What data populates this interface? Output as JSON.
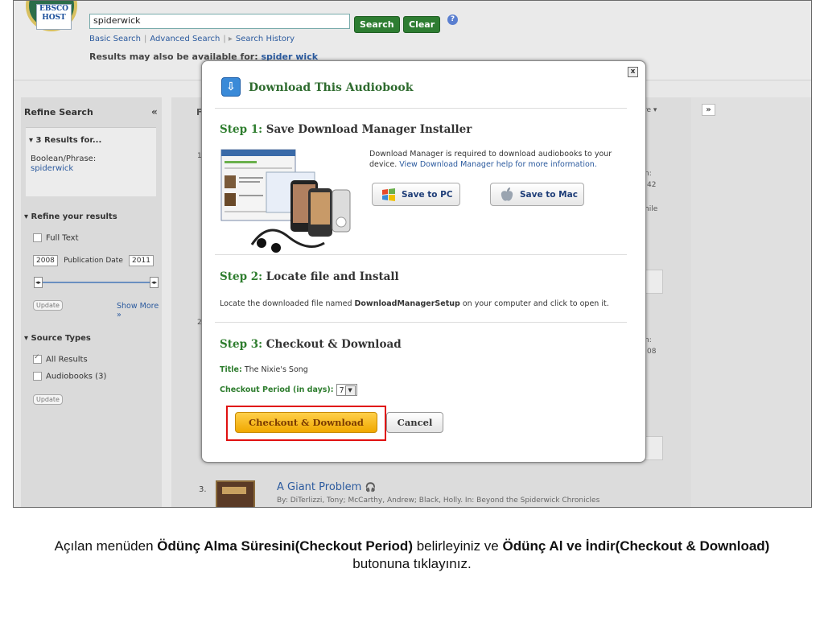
{
  "header": {
    "logo_text": "EBSCO HOST",
    "search_value": "spiderwick",
    "search_button": "Search",
    "clear_button": "Clear",
    "help_icon": "?",
    "nav_links": [
      "Basic Search",
      "Advanced Search",
      "Search History"
    ],
    "may_also_text": "Results may also be available for:",
    "may_also_link": "spider wick"
  },
  "sidebar": {
    "title": "Refine Search",
    "collapse_icon": "«",
    "results_for": "3 Results for...",
    "boolean_label": "Boolean/Phrase:",
    "boolean_value": "spiderwick",
    "refine_header": "Refine your results",
    "full_text": "Full Text",
    "date_from": "2008",
    "date_label": "Publication Date",
    "date_to": "2011",
    "update_label": "Update",
    "show_more": "Show More »",
    "source_types_header": "Source Types",
    "all_results": "All Results",
    "audiobooks": "Audiobooks (3)"
  },
  "background": {
    "expand_icon": "»",
    "col_letter": "F",
    "re_menu": "re ▾",
    "frag_n1": "n:",
    "frag_42": ":42",
    "frag_hile": "hile",
    "frag_n2": "n:",
    "frag_08": ":08",
    "num_1": "1",
    "num_2": "2",
    "result3_num": "3.",
    "result3_title": "A Giant Problem",
    "result3_by": "By: DiTerlizzi, Tony; McCarthy, Andrew; Black, Holly. In: Beyond the Spiderwick Chronicles"
  },
  "modal": {
    "title": "Download This Audiobook",
    "close_label": "x",
    "step1_num": "Step 1:",
    "step1_text": "Save Download Manager Installer",
    "info_text": "Download Manager is required to download audiobooks to your device.",
    "info_link": "View Download Manager help for more information.",
    "save_pc": "Save to PC",
    "save_mac": "Save to Mac",
    "step2_num": "Step 2:",
    "step2_text": "Locate file and Install",
    "step2_pre": "Locate the downloaded file named",
    "step2_file": "DownloadManagerSetup",
    "step2_post": "on your computer and click to open it.",
    "step3_num": "Step 3:",
    "step3_text": "Checkout & Download",
    "title_key": "Title:",
    "title_value": "The Nixie's Song",
    "period_key": "Checkout Period (in days):",
    "period_value": "7",
    "checkout_button": "Checkout & Download",
    "cancel_button": "Cancel"
  },
  "caption": {
    "p1": "Açılan menüden",
    "b1": "Ödünç Alma Süresini(Checkout Period)",
    "p2": "belirleyiniz ve",
    "b2": "Ödünç Al ve İndir(Checkout & Download)",
    "p3": "butonuna tıklayınız."
  },
  "colors": {
    "accent_green": "#2e7d32",
    "checkout_orange": "#f0a800",
    "highlight_red": "#e01010",
    "link_blue": "#2b5a9e"
  }
}
